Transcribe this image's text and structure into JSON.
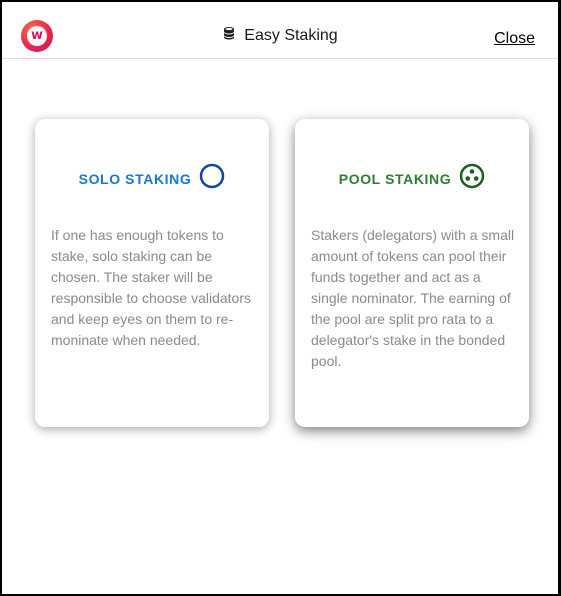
{
  "header": {
    "title": "Easy Staking",
    "close_label": "Close",
    "logo_icon": "w-logo-icon",
    "title_icon": "coins-stack-icon"
  },
  "cards": [
    {
      "title": "SOLO STAKING",
      "title_color": "#1976d2",
      "icon": "circle-outline-icon",
      "icon_color": "#0d47a1",
      "description": "If one has enough tokens to stake, solo staking can be chosen. The staker will be responsible to choose validators and keep eyes on them to re-moninate when needed."
    },
    {
      "title": "POOL STAKING",
      "title_color": "#2e7d32",
      "icon": "pool-circles-icon",
      "icon_color": "#1b5e20",
      "description": "Stakers (delegators) with a small amount of tokens can pool their funds together and act as a single nominator. The earning of the pool are split pro rata to a delegator's stake in the bonded pool."
    }
  ]
}
